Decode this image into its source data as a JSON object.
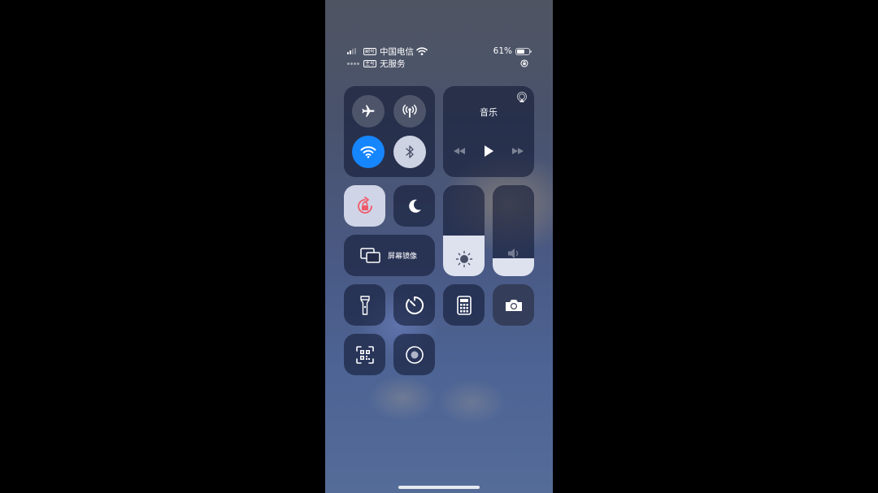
{
  "status_bar": {
    "sim1_tag": "副号",
    "carrier": "中国电信",
    "battery_percent": "61%",
    "battery_level": 0.61,
    "sim2_tag": "主号",
    "sim2_status": "无服务"
  },
  "connectivity": {
    "airplane_icon": "airplane-icon",
    "cellular_icon": "cellular-antenna-icon",
    "wifi_icon": "wifi-icon",
    "bluetooth_icon": "bluetooth-icon",
    "wifi_color": "#1686ff"
  },
  "music": {
    "title": "音乐",
    "airplay_icon": "airplay-icon",
    "prev_icon": "rewind-icon",
    "play_icon": "play-icon",
    "next_icon": "fast-forward-icon"
  },
  "controls": {
    "orientation_lock_icon": "orientation-lock-icon",
    "orientation_lock_color": "#f05a6a",
    "do_not_disturb_icon": "moon-icon",
    "screen_mirroring_label": "屏幕镜像",
    "brightness_level": 0.45,
    "volume_level": 0.2
  },
  "shortcuts": [
    {
      "icon": "flashlight-icon"
    },
    {
      "icon": "timer-icon"
    },
    {
      "icon": "calculator-icon"
    },
    {
      "icon": "camera-icon"
    },
    {
      "icon": "qr-code-scanner-icon"
    },
    {
      "icon": "screen-recording-icon"
    }
  ]
}
